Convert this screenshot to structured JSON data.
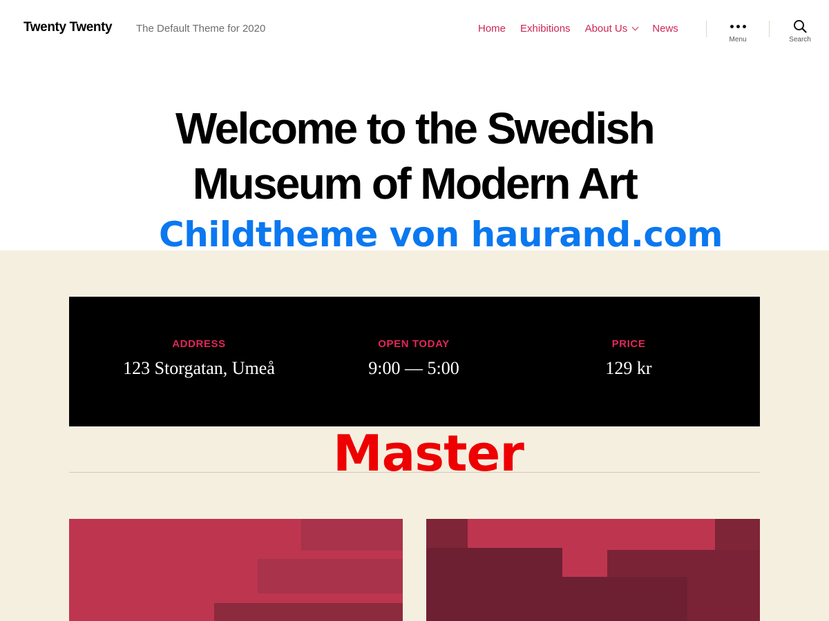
{
  "header": {
    "site_title": "Twenty Twenty",
    "site_description": "The Default Theme for 2020",
    "nav": [
      {
        "label": "Home",
        "has_dropdown": false
      },
      {
        "label": "Exhibitions",
        "has_dropdown": false
      },
      {
        "label": "About Us",
        "has_dropdown": true
      },
      {
        "label": "News",
        "has_dropdown": false
      }
    ],
    "menu_label": "Menu",
    "search_label": "Search",
    "icons": {
      "menu": "ellipsis-icon",
      "search": "search-icon",
      "dropdown": "chevron-down-icon"
    }
  },
  "hero": {
    "title_line1": "Welcome to the Swedish",
    "title_line2": "Museum of Modern Art"
  },
  "overlays": {
    "childtheme": "Childtheme von haurand.com",
    "master": "Master"
  },
  "info": {
    "columns": [
      {
        "label": "ADDRESS",
        "value": "123 Storgatan, Umeå"
      },
      {
        "label": "OPEN TODAY",
        "value": "9:00 — 5:00"
      },
      {
        "label": "PRICE",
        "value": "129 kr"
      }
    ]
  },
  "colors": {
    "accent": "#cd2653",
    "info_label": "#e22658",
    "beige_bg": "#f5efe0",
    "info_bg": "#000000",
    "overlay_blue": "#0b78f0",
    "overlay_red": "#ee0000",
    "art_pink": "#be3550",
    "art_dark": "#6e2033"
  }
}
